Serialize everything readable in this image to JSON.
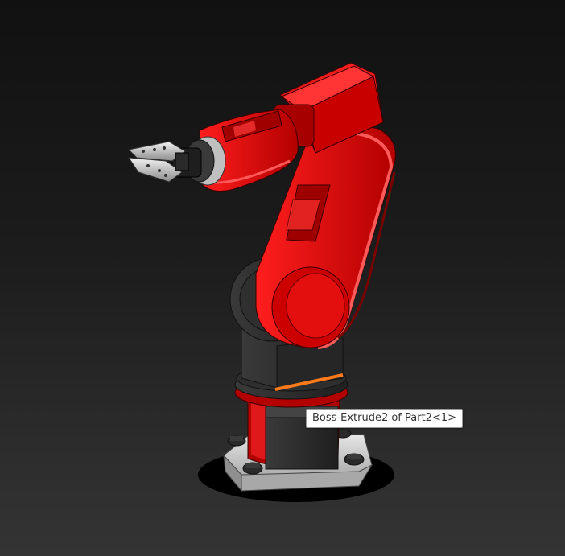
{
  "viewport": {
    "background_top": "#111111",
    "background_bottom": "#343434"
  },
  "model": {
    "primary_color": "#d40000",
    "joint_color": "#2b2b2b",
    "base_color": "#cfcfcf",
    "selection_highlight_color": "#ff7a1a"
  },
  "tooltip": {
    "text": "Boss-Extrude2 of Part2<1>"
  }
}
